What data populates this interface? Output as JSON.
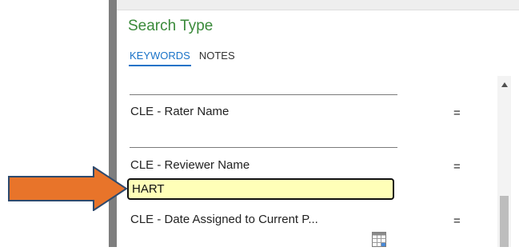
{
  "panel": {
    "title": "Search Type",
    "tabs": [
      {
        "label": "KEYWORDS",
        "active": true
      },
      {
        "label": "NOTES",
        "active": false
      }
    ]
  },
  "fields": [
    {
      "label": "CLE - Rater Name",
      "operator": "="
    },
    {
      "label": "CLE - Reviewer Name",
      "operator": "=",
      "value": "HART"
    },
    {
      "label": "CLE - Date Assigned to Current P...",
      "operator": "="
    }
  ],
  "colors": {
    "title_green": "#3a8a3a",
    "tab_active_blue": "#1a73c8",
    "input_highlight": "#ffffb8",
    "annotation_arrow": "#e8742a"
  },
  "icons": {
    "calendar": "calendar-icon",
    "scroll_up": "scroll-up-icon",
    "annotation_arrow": "annotation-arrow-icon"
  }
}
